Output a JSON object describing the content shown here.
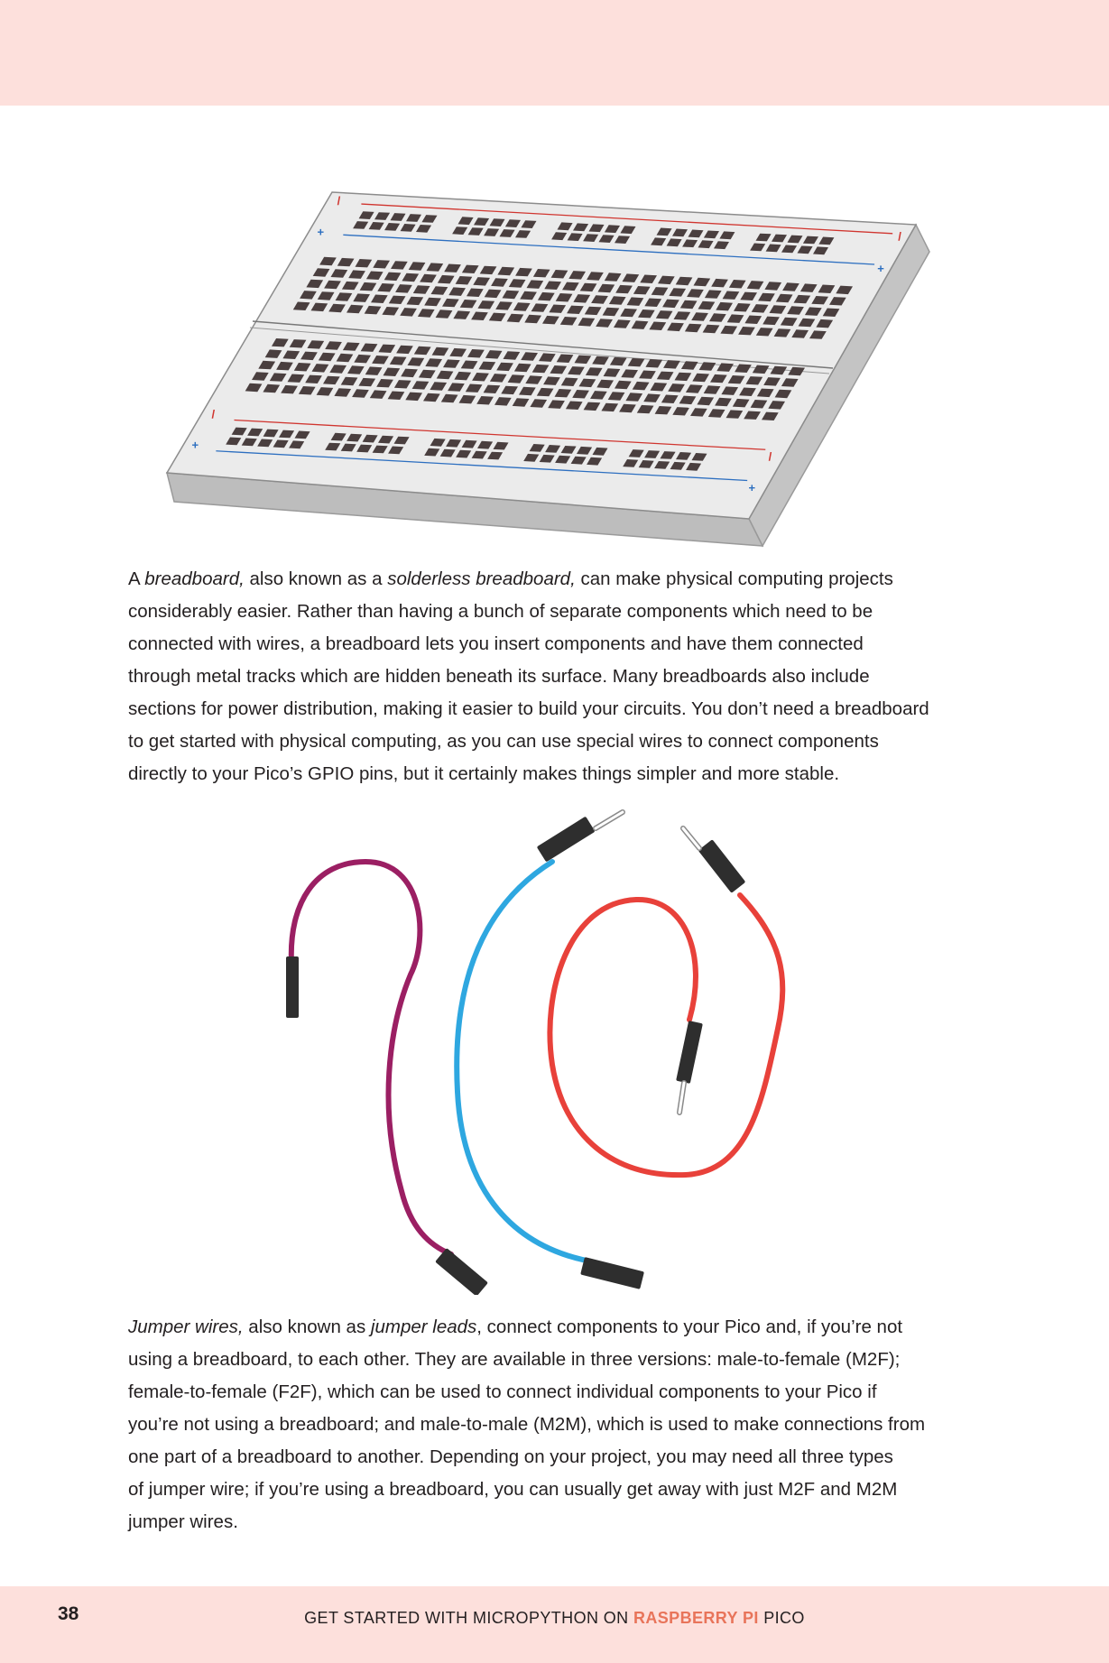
{
  "header": {},
  "figures": {
    "breadboard": {
      "icon": "breadboard-illustration",
      "rail_plus": "+",
      "rail_minus": "/",
      "colors": {
        "red_rail": "#d0352f",
        "blue_rail": "#2d6fc0",
        "hole": "#4a3f3f",
        "board_top": "#ebebeb",
        "board_side": "#c4c4c4"
      }
    },
    "jumper_wires": {
      "icon": "jumper-wires-illustration",
      "colors": {
        "purple": "#9b1f63",
        "blue": "#2ea7e0",
        "red": "#e8413a",
        "connector": "#2e2e2e"
      }
    }
  },
  "para1": [
    [
      {
        "t": "A "
      },
      {
        "t": "breadboard,",
        "i": true
      },
      {
        "t": " also known as a "
      },
      {
        "t": "solderless breadboard,",
        "i": true
      },
      {
        "t": " can make physical computing projects"
      }
    ],
    [
      {
        "t": "considerably easier. Rather than having a bunch of separate components which need to be"
      }
    ],
    [
      {
        "t": "connected with wires, a breadboard lets you insert components and have them connected"
      }
    ],
    [
      {
        "t": "through metal tracks which are hidden beneath its surface. Many breadboards also include"
      }
    ],
    [
      {
        "t": "sections for power distribution, making it easier to build your circuits. You don’t need a breadboard"
      }
    ],
    [
      {
        "t": "to get started with physical computing, as you can use special wires to connect components"
      }
    ],
    [
      {
        "t": "directly to your Pico’s GPIO pins, but it certainly makes things simpler and more stable."
      }
    ]
  ],
  "para2": [
    [
      {
        "t": "Jumper wires,",
        "i": true
      },
      {
        "t": " also known as "
      },
      {
        "t": "jumper leads",
        "i": true
      },
      {
        "t": ", connect components to your Pico and, if you’re not"
      }
    ],
    [
      {
        "t": "using a breadboard, to each other. They are available in three versions: male-to-female (M2F);"
      }
    ],
    [
      {
        "t": "female-to-female (F2F), which can be used to connect individual components to your Pico if"
      }
    ],
    [
      {
        "t": "you’re not using a breadboard; and male-to-male (M2M), which is used to make connections from"
      }
    ],
    [
      {
        "t": "one part of a breadboard to another. Depending on your project, you may need all three types"
      }
    ],
    [
      {
        "t": "of jumper wire; if you’re using a breadboard, you can usually get away with just M2F and M2M"
      }
    ],
    [
      {
        "t": "jumper wires."
      }
    ]
  ],
  "footer": {
    "page_number": "38",
    "title_before": "GET STARTED WITH MICROPYTHON ON ",
    "title_brand": "RASPBERRY PI",
    "title_after": " PICO"
  }
}
